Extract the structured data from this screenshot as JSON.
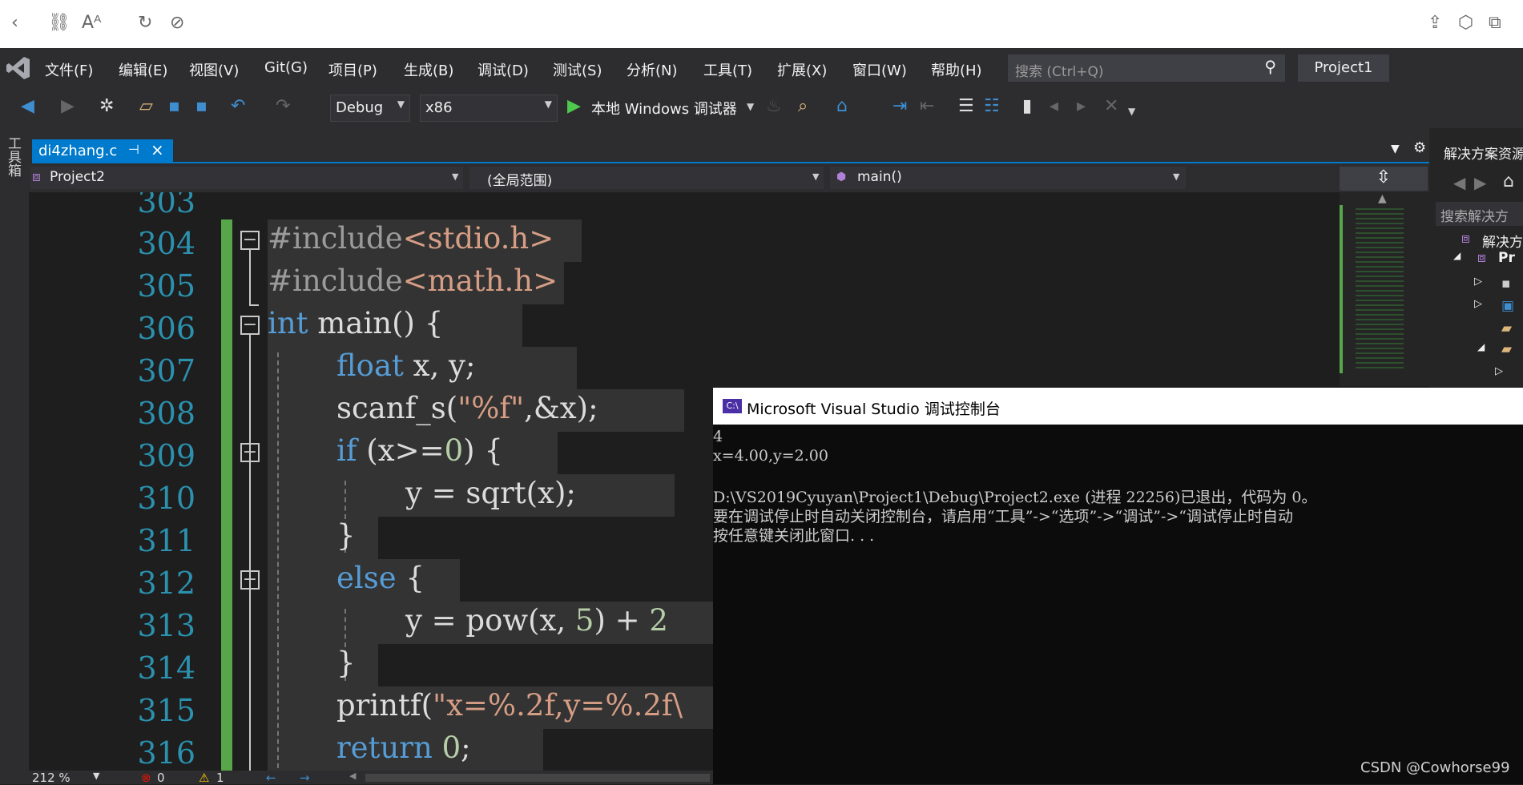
{
  "menu": {
    "items": [
      "文件(F)",
      "编辑(E)",
      "视图(V)",
      "Git(G)",
      "项目(P)",
      "生成(B)",
      "调试(D)",
      "测试(S)",
      "分析(N)",
      "工具(T)",
      "扩展(X)",
      "窗口(W)",
      "帮助(H)"
    ],
    "search_placeholder": "搜索 (Ctrl+Q)",
    "project_badge": "Project1"
  },
  "toolbar": {
    "config": "Debug",
    "platform": "x86",
    "run_label": "本地 Windows 调试器"
  },
  "left_strip": {
    "label": "工具箱"
  },
  "tabs": [
    {
      "label": "di4zhang.c",
      "active": true
    }
  ],
  "navbar": {
    "project": "Project2",
    "scope": "(全局范围)",
    "member": "main()"
  },
  "editor": {
    "line_numbers": [
      "303",
      "304",
      "305",
      "306",
      "307",
      "308",
      "309",
      "310",
      "311",
      "312",
      "313",
      "314",
      "315",
      "316"
    ],
    "code": {
      "l304_a": "#include",
      "l304_b": "<stdio.h>",
      "l305_a": "#include",
      "l305_b": "<math.h>",
      "l306_kw": "int",
      "l306_rest": " main() {",
      "l307_kw": "float",
      "l307_rest": " x, y;",
      "l308_a": "scanf_s(",
      "l308_str": "\"%f\"",
      "l308_b": ",&x);",
      "l309_kw": "if",
      "l309_a": " (x>=",
      "l309_num": "0",
      "l309_b": ") {",
      "l310": "y = sqrt(x);",
      "l311": "}",
      "l312_kw": "else",
      "l312_rest": " {",
      "l313_a": "y = pow(x, ",
      "l313_num1": "5",
      "l313_b": ") + ",
      "l313_num2": "2",
      "l314": "}",
      "l315_a": "printf(",
      "l315_str": "\"x=%.2f,y=%.2f\\",
      "l316_kw": "return",
      "l316_rest": " ",
      "l316_num": "0",
      "l316_end": ";"
    }
  },
  "solution_explorer": {
    "title": "解决方案资源",
    "search": "搜索解决方",
    "tree": [
      "解决方",
      "Pr"
    ]
  },
  "console": {
    "title": "Microsoft Visual Studio 调试控制台",
    "lines": [
      "4",
      "x=4.00,y=2.00",
      "",
      "D:\\VS2019Cyuyan\\Project1\\Debug\\Project2.exe (进程 22256)已退出，代码为 0。",
      "要在调试停止时自动关闭控制台，请启用“工具”->“选项”->“调试”->“调试停止时自动",
      "按任意键关闭此窗口. . ."
    ]
  },
  "status": {
    "zoom": "212 %",
    "errors": "0",
    "warnings": "1"
  },
  "watermark": "CSDN @Cowhorse99",
  "colors": {
    "accent": "#007acc",
    "keyword": "#569cd6",
    "string": "#d69d85",
    "number": "#b5cea8",
    "line_number": "#2b91af",
    "change_bar": "#57a64a"
  }
}
